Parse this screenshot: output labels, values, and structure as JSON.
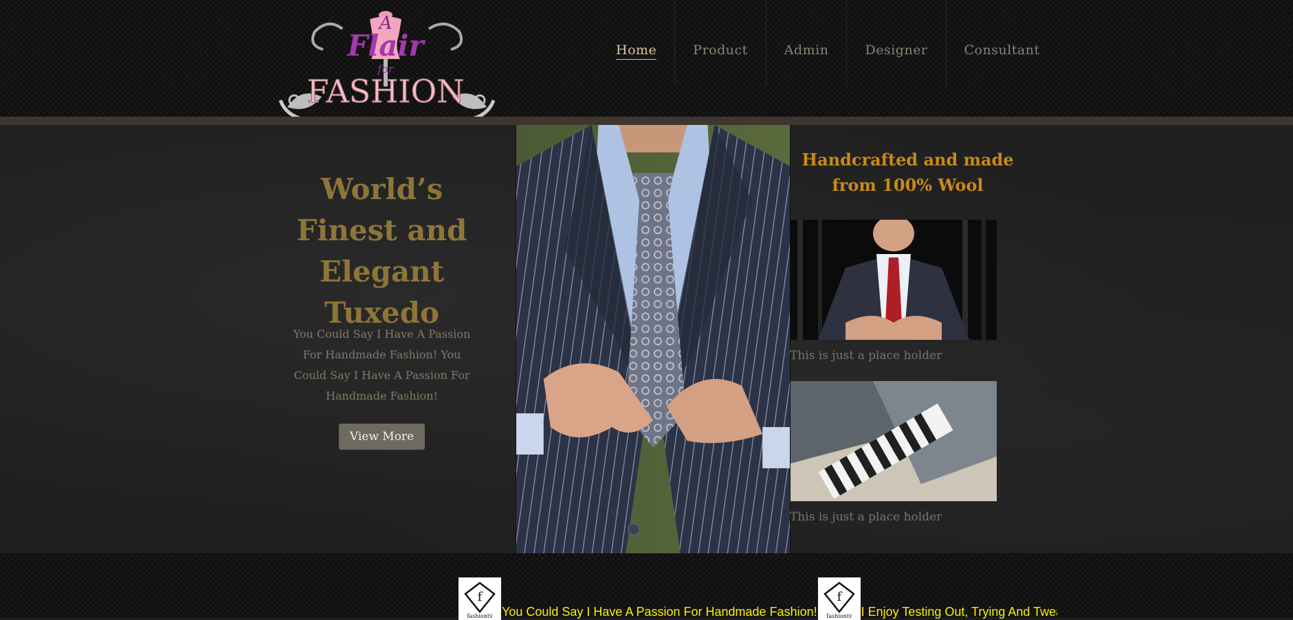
{
  "brand": {
    "logo_line1": "A",
    "logo_line2": "Flair",
    "logo_line3": "for",
    "logo_line4": "FASHION"
  },
  "nav": {
    "items": [
      {
        "label": "Home",
        "active": true
      },
      {
        "label": "Product",
        "active": false
      },
      {
        "label": "Admin",
        "active": false
      },
      {
        "label": "Designer",
        "active": false
      },
      {
        "label": "Consultant",
        "active": false
      }
    ]
  },
  "hero": {
    "title": "World’s Finest and Elegant Tuxedo",
    "text": "You Could Say I Have A Passion For Handmade Fashion! You Could Say I Have A Passion For Handmade Fashion!",
    "button_label": "View More"
  },
  "right": {
    "title": "Handcrafted and made from 100% Wool",
    "captions": [
      "This is just a place holder",
      "This is just a place holder"
    ]
  },
  "footer": {
    "ticker_logo_label": "fashiontv",
    "ticker_items": [
      "You Could Say I Have A Passion For Handmade Fashion!",
      "I Enjoy Testing Out, Trying And Tweak"
    ]
  },
  "colors": {
    "accent_gold": "#8e7538",
    "orange_title": "#c98a18",
    "ticker_yellow": "#ffef00",
    "nav_active": "#d7c89c"
  }
}
